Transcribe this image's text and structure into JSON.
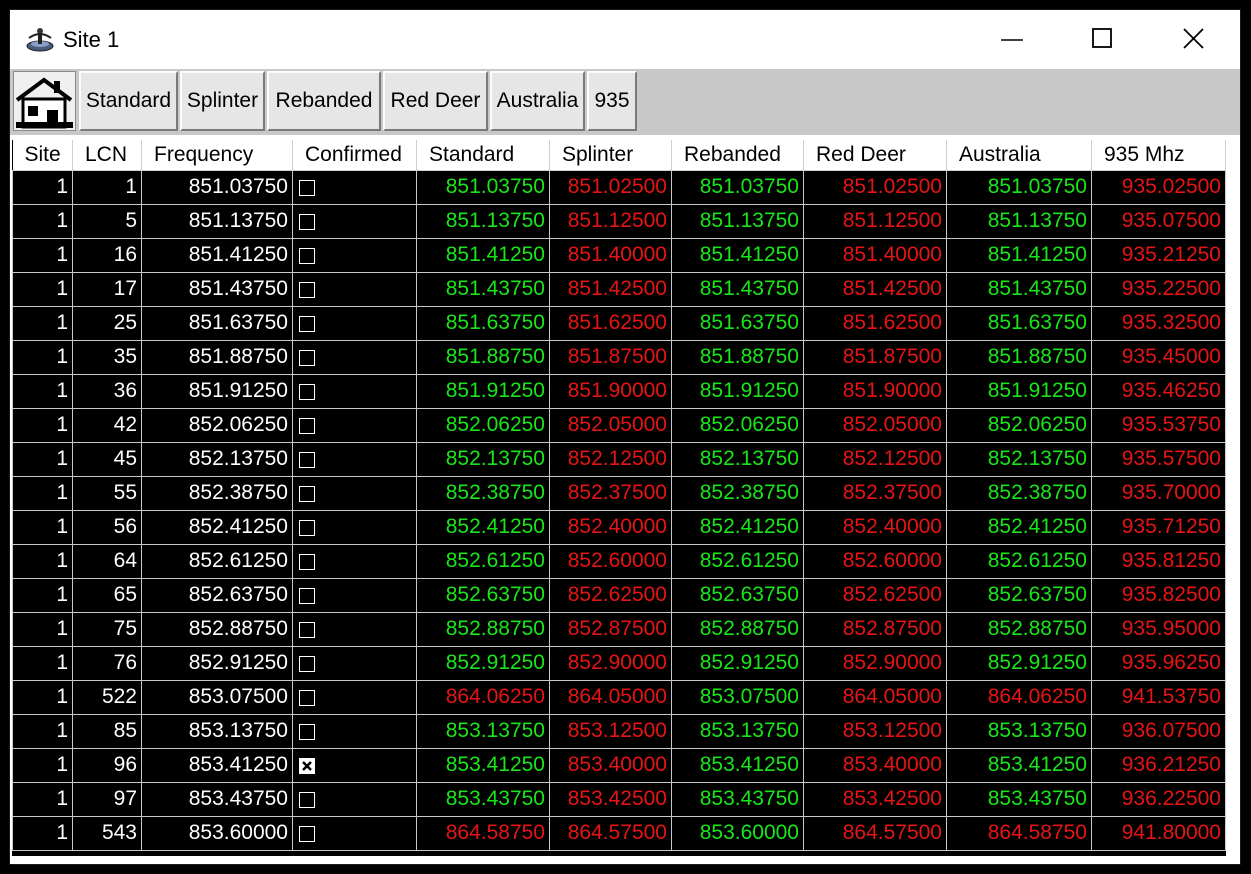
{
  "window": {
    "title": "Site 1",
    "icon": "radio-tower-icon"
  },
  "tabs": {
    "home_icon": "house-icon",
    "items": [
      "Standard",
      "Splinter",
      "Rebanded",
      "Red Deer",
      "Australia",
      "935"
    ]
  },
  "grid": {
    "columns": [
      "Site",
      "LCN",
      "Frequency",
      "Confirmed",
      "Standard",
      "Splinter",
      "Rebanded",
      "Red Deer",
      "Australia",
      "935 Mhz"
    ],
    "colors": {
      "green": "#19e619",
      "red": "#e61414"
    },
    "rows": [
      {
        "site": "1",
        "lcn": "1",
        "freq": "851.03750",
        "confirmed": false,
        "c": [
          "851.03750",
          "851.02500",
          "851.03750",
          "851.02500",
          "851.03750",
          "935.02500"
        ],
        "col": [
          "g",
          "r",
          "g",
          "r",
          "g",
          "r"
        ]
      },
      {
        "site": "1",
        "lcn": "5",
        "freq": "851.13750",
        "confirmed": false,
        "c": [
          "851.13750",
          "851.12500",
          "851.13750",
          "851.12500",
          "851.13750",
          "935.07500"
        ],
        "col": [
          "g",
          "r",
          "g",
          "r",
          "g",
          "r"
        ]
      },
      {
        "site": "1",
        "lcn": "16",
        "freq": "851.41250",
        "confirmed": false,
        "c": [
          "851.41250",
          "851.40000",
          "851.41250",
          "851.40000",
          "851.41250",
          "935.21250"
        ],
        "col": [
          "g",
          "r",
          "g",
          "r",
          "g",
          "r"
        ]
      },
      {
        "site": "1",
        "lcn": "17",
        "freq": "851.43750",
        "confirmed": false,
        "c": [
          "851.43750",
          "851.42500",
          "851.43750",
          "851.42500",
          "851.43750",
          "935.22500"
        ],
        "col": [
          "g",
          "r",
          "g",
          "r",
          "g",
          "r"
        ]
      },
      {
        "site": "1",
        "lcn": "25",
        "freq": "851.63750",
        "confirmed": false,
        "c": [
          "851.63750",
          "851.62500",
          "851.63750",
          "851.62500",
          "851.63750",
          "935.32500"
        ],
        "col": [
          "g",
          "r",
          "g",
          "r",
          "g",
          "r"
        ]
      },
      {
        "site": "1",
        "lcn": "35",
        "freq": "851.88750",
        "confirmed": false,
        "c": [
          "851.88750",
          "851.87500",
          "851.88750",
          "851.87500",
          "851.88750",
          "935.45000"
        ],
        "col": [
          "g",
          "r",
          "g",
          "r",
          "g",
          "r"
        ]
      },
      {
        "site": "1",
        "lcn": "36",
        "freq": "851.91250",
        "confirmed": false,
        "c": [
          "851.91250",
          "851.90000",
          "851.91250",
          "851.90000",
          "851.91250",
          "935.46250"
        ],
        "col": [
          "g",
          "r",
          "g",
          "r",
          "g",
          "r"
        ]
      },
      {
        "site": "1",
        "lcn": "42",
        "freq": "852.06250",
        "confirmed": false,
        "c": [
          "852.06250",
          "852.05000",
          "852.06250",
          "852.05000",
          "852.06250",
          "935.53750"
        ],
        "col": [
          "g",
          "r",
          "g",
          "r",
          "g",
          "r"
        ]
      },
      {
        "site": "1",
        "lcn": "45",
        "freq": "852.13750",
        "confirmed": false,
        "c": [
          "852.13750",
          "852.12500",
          "852.13750",
          "852.12500",
          "852.13750",
          "935.57500"
        ],
        "col": [
          "g",
          "r",
          "g",
          "r",
          "g",
          "r"
        ]
      },
      {
        "site": "1",
        "lcn": "55",
        "freq": "852.38750",
        "confirmed": false,
        "c": [
          "852.38750",
          "852.37500",
          "852.38750",
          "852.37500",
          "852.38750",
          "935.70000"
        ],
        "col": [
          "g",
          "r",
          "g",
          "r",
          "g",
          "r"
        ]
      },
      {
        "site": "1",
        "lcn": "56",
        "freq": "852.41250",
        "confirmed": false,
        "c": [
          "852.41250",
          "852.40000",
          "852.41250",
          "852.40000",
          "852.41250",
          "935.71250"
        ],
        "col": [
          "g",
          "r",
          "g",
          "r",
          "g",
          "r"
        ]
      },
      {
        "site": "1",
        "lcn": "64",
        "freq": "852.61250",
        "confirmed": false,
        "c": [
          "852.61250",
          "852.60000",
          "852.61250",
          "852.60000",
          "852.61250",
          "935.81250"
        ],
        "col": [
          "g",
          "r",
          "g",
          "r",
          "g",
          "r"
        ]
      },
      {
        "site": "1",
        "lcn": "65",
        "freq": "852.63750",
        "confirmed": false,
        "c": [
          "852.63750",
          "852.62500",
          "852.63750",
          "852.62500",
          "852.63750",
          "935.82500"
        ],
        "col": [
          "g",
          "r",
          "g",
          "r",
          "g",
          "r"
        ]
      },
      {
        "site": "1",
        "lcn": "75",
        "freq": "852.88750",
        "confirmed": false,
        "c": [
          "852.88750",
          "852.87500",
          "852.88750",
          "852.87500",
          "852.88750",
          "935.95000"
        ],
        "col": [
          "g",
          "r",
          "g",
          "r",
          "g",
          "r"
        ]
      },
      {
        "site": "1",
        "lcn": "76",
        "freq": "852.91250",
        "confirmed": false,
        "c": [
          "852.91250",
          "852.90000",
          "852.91250",
          "852.90000",
          "852.91250",
          "935.96250"
        ],
        "col": [
          "g",
          "r",
          "g",
          "r",
          "g",
          "r"
        ]
      },
      {
        "site": "1",
        "lcn": "522",
        "freq": "853.07500",
        "confirmed": false,
        "c": [
          "864.06250",
          "864.05000",
          "853.07500",
          "864.05000",
          "864.06250",
          "941.53750"
        ],
        "col": [
          "r",
          "r",
          "g",
          "r",
          "r",
          "r"
        ]
      },
      {
        "site": "1",
        "lcn": "85",
        "freq": "853.13750",
        "confirmed": false,
        "c": [
          "853.13750",
          "853.12500",
          "853.13750",
          "853.12500",
          "853.13750",
          "936.07500"
        ],
        "col": [
          "g",
          "r",
          "g",
          "r",
          "g",
          "r"
        ]
      },
      {
        "site": "1",
        "lcn": "96",
        "freq": "853.41250",
        "confirmed": true,
        "c": [
          "853.41250",
          "853.40000",
          "853.41250",
          "853.40000",
          "853.41250",
          "936.21250"
        ],
        "col": [
          "g",
          "r",
          "g",
          "r",
          "g",
          "r"
        ]
      },
      {
        "site": "1",
        "lcn": "97",
        "freq": "853.43750",
        "confirmed": false,
        "c": [
          "853.43750",
          "853.42500",
          "853.43750",
          "853.42500",
          "853.43750",
          "936.22500"
        ],
        "col": [
          "g",
          "r",
          "g",
          "r",
          "g",
          "r"
        ]
      },
      {
        "site": "1",
        "lcn": "543",
        "freq": "853.60000",
        "confirmed": false,
        "c": [
          "864.58750",
          "864.57500",
          "853.60000",
          "864.57500",
          "864.58750",
          "941.80000"
        ],
        "col": [
          "r",
          "r",
          "g",
          "r",
          "r",
          "r"
        ]
      }
    ]
  }
}
